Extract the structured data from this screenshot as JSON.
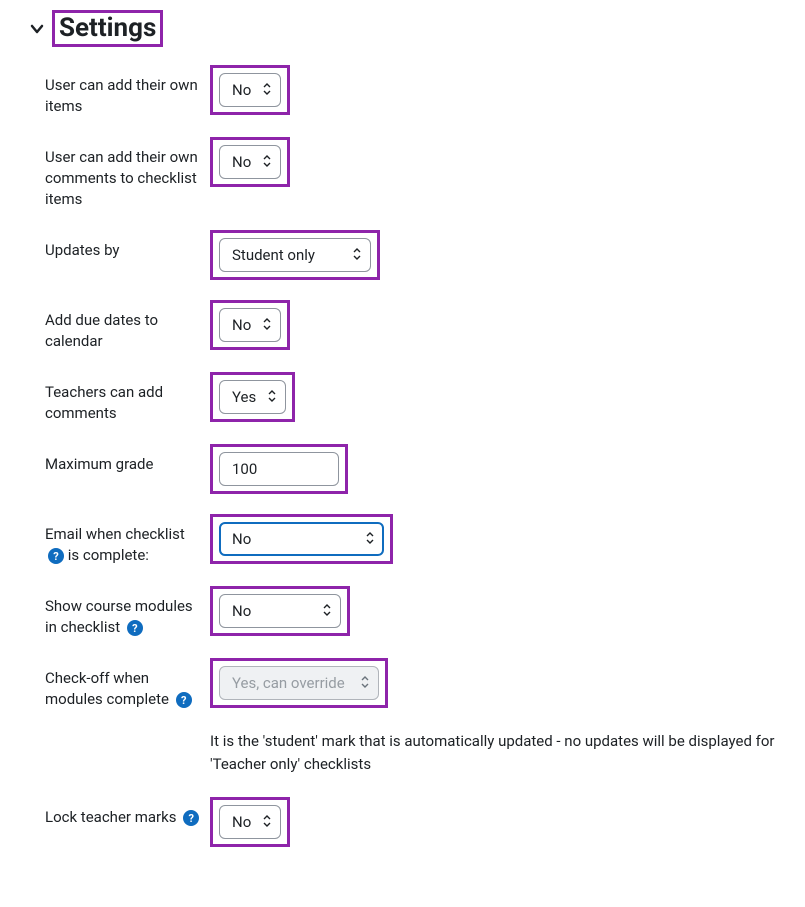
{
  "section": {
    "title": "Settings"
  },
  "fields": {
    "user_add_items": {
      "label": "User can add their own items",
      "value": "No"
    },
    "user_add_comments": {
      "label": "User can add their own comments to checklist items",
      "value": "No"
    },
    "updates_by": {
      "label": "Updates by",
      "value": "Student only"
    },
    "add_due_dates": {
      "label": "Add due dates to calendar",
      "value": "No"
    },
    "teachers_comments": {
      "label": "Teachers can add comments",
      "value": "Yes"
    },
    "max_grade": {
      "label": "Maximum grade",
      "value": "100"
    },
    "email_complete": {
      "label": "Email when checklist is complete:",
      "value": "No"
    },
    "show_modules": {
      "label": "Show course modules in checklist",
      "value": "No"
    },
    "checkoff_modules": {
      "label": "Check-off when modules complete",
      "value": "Yes, can override"
    },
    "lock_teacher": {
      "label": "Lock teacher marks",
      "value": "No"
    }
  },
  "note": "It is the 'student' mark that is automatically updated - no updates will be displayed for 'Teacher only' checklists"
}
